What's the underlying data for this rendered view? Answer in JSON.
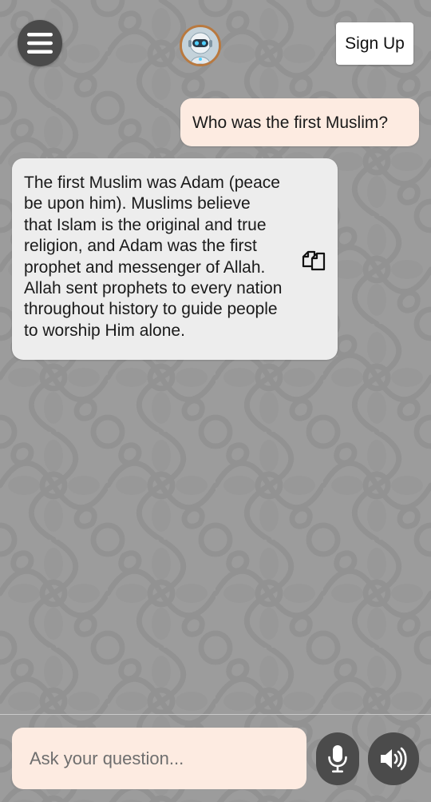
{
  "header": {
    "menu_icon": "hamburger-menu-icon",
    "avatar_icon": "robot-avatar-icon",
    "signup_label": "Sign Up"
  },
  "chat": {
    "messages": [
      {
        "role": "user",
        "text": "Who was the first Muslim?"
      },
      {
        "role": "assistant",
        "lines": [
          "The first Muslim was Adam (peace",
          "be upon him). Muslims believe",
          "that Islam is the original and true",
          "religion, and Adam was the first",
          "prophet and messenger of Allah.",
          "Allah sent prophets to every nation",
          "throughout history to guide people",
          "to worship Him alone."
        ],
        "copy_icon": "copy-icon"
      }
    ]
  },
  "composer": {
    "placeholder": "Ask your question...",
    "value": "",
    "mic_icon": "microphone-icon",
    "speaker_icon": "speaker-icon"
  },
  "colors": {
    "background": "#9c9c9c",
    "pattern": "#8f8f8f",
    "user_bubble": "#fdebe1",
    "bot_bubble": "#ededed",
    "dark_button": "#4b4b4b",
    "avatar_ring": "#b9793f"
  }
}
